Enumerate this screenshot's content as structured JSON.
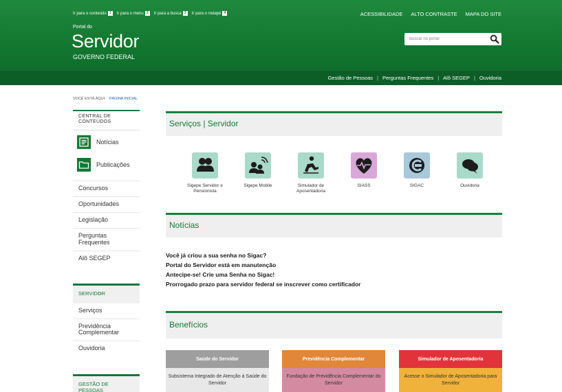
{
  "header": {
    "access_links": [
      {
        "label": "Ir para o conteúdo",
        "key": "1"
      },
      {
        "label": "Ir para o menu",
        "key": "2"
      },
      {
        "label": "Ir para a busca",
        "key": "3"
      },
      {
        "label": "Ir para o rodapé",
        "key": "4"
      }
    ],
    "top_links": [
      "ACESSIBILIDADE",
      "ALTO CONTRASTE",
      "MAPA DO SITE"
    ],
    "portal_small": "Portal do",
    "portal_big": "Servidor",
    "portal_gov": "GOVERNO FEDERAL",
    "search": {
      "placeholder": "Buscar no portal",
      "icon": "search-icon"
    },
    "nav_links": [
      "Gestão de Pessoas",
      "Perguntas Frequentes",
      "Alô SEGEP",
      "Ouvidoria"
    ],
    "colors": {
      "green": "#147a32",
      "dark_green": "#0d5d26"
    }
  },
  "breadcrumb": {
    "label": "VOCÊ ESTÁ AQUI:",
    "current": "PÁGINA INICIAL"
  },
  "sidebar": {
    "central_heading": "CENTRAL DE CONTEÚDOS",
    "icon_items": [
      {
        "label": "Notícias",
        "icon": "news-icon"
      },
      {
        "label": "Publicações",
        "icon": "folder-icon"
      }
    ],
    "links": [
      "Concursos",
      "Oportunidades",
      "Legislação",
      "Perguntas Frequentes",
      "Alô SEGEP"
    ],
    "servidor_heading": "SERVIDOR",
    "servidor_links": [
      "Serviços",
      "Previdência Complementar",
      "Ouvidoria"
    ],
    "gestao_heading": "GESTÃO DE PESSOAS"
  },
  "main": {
    "services_title": "Serviços | Servidor",
    "services": [
      {
        "label": "Sigepe Servidor e Pensionista",
        "icon": "users-icon",
        "bg": "#a9d9c9"
      },
      {
        "label": "Sigepe Mobile",
        "icon": "mobile-users-icon",
        "bg": "#a9d9c9"
      },
      {
        "label": "Simulador de Aposentadoria",
        "icon": "retirement-icon",
        "bg": "#a9d9c9"
      },
      {
        "label": "SIASS",
        "icon": "heart-pulse-icon",
        "bg": "#d8a8d8"
      },
      {
        "label": "SIGAC",
        "icon": "sigac-icon",
        "bg": "#a9c9d9"
      },
      {
        "label": "Ouvidoria",
        "icon": "chat-bubbles-icon",
        "bg": "#a9d9c9"
      }
    ],
    "news_title": "Notícias",
    "news": [
      "Você já criou a sua senha no Sigac?",
      "Portal do Servidor está em manutenção",
      "Antecipe-se! Crie uma Senha no Sigac!",
      "Prorrogado prazo para servidor federal se inscrever como certificador"
    ],
    "benefits_title": "Benefícios",
    "cards": [
      {
        "head": "Saúde do Servidor",
        "body": "Subsistema Integrado de Atenção à Saúde do Servidor",
        "head_bg": "#9e9e9e",
        "body_bg": "#e8e8e8"
      },
      {
        "head": "Previdência Complementar",
        "body": "Fundação de Previdência Complementar do Servidor",
        "head_bg": "#e0873a",
        "body_bg": "#d48aa0"
      },
      {
        "head": "Simulador de Aposentadoria",
        "body": "Acesse o Simulador de Aposentadoria para Servidor",
        "head_bg": "#e2333a",
        "body_bg": "#f0b23a"
      }
    ]
  }
}
